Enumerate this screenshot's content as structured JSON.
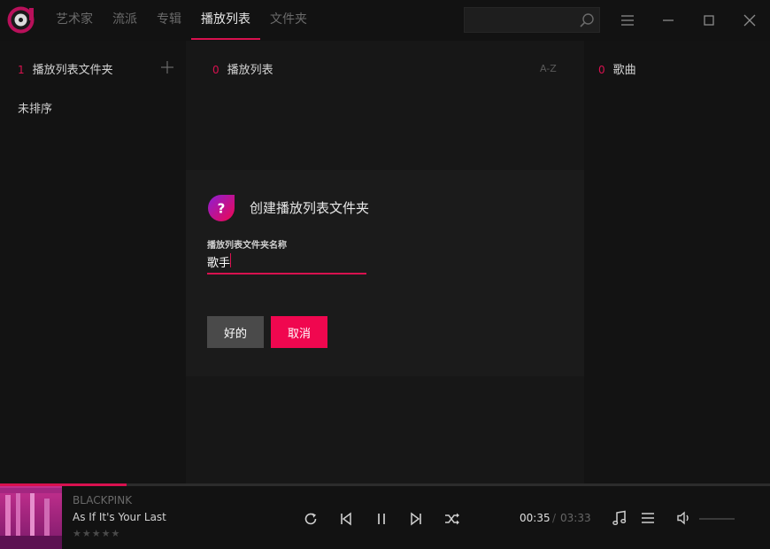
{
  "nav": {
    "tabs": [
      {
        "label": "艺术家"
      },
      {
        "label": "流派"
      },
      {
        "label": "专辑"
      },
      {
        "label": "播放列表"
      },
      {
        "label": "文件夹"
      }
    ],
    "active_index": 3
  },
  "search": {
    "placeholder": "",
    "icon": "search-icon"
  },
  "window_controls": [
    "menu-icon",
    "minimize-icon",
    "maximize-icon",
    "close-icon"
  ],
  "left_column": {
    "count": "1",
    "header": "播放列表文件夹",
    "add_icon": "plus-icon",
    "items": [
      {
        "label": "未排序"
      }
    ]
  },
  "middle_column": {
    "count": "0",
    "header": "播放列表",
    "sort_label": "A-Z"
  },
  "right_column": {
    "count": "0",
    "header": "歌曲"
  },
  "dialog": {
    "title": "创建播放列表文件夹",
    "icon": "question-icon",
    "field_label": "播放列表文件夹名称",
    "field_value": "歌手",
    "ok_label": "好的",
    "cancel_label": "取消"
  },
  "player": {
    "artist": "BLACKPINK",
    "title": "As If It's Your Last",
    "rating": 0,
    "rating_max": 5,
    "time_current": "00:35",
    "time_separator": "/",
    "time_total": "03:33",
    "progress_fraction": 0.164,
    "controls": [
      "repeat-icon",
      "previous-icon",
      "pause-icon",
      "next-icon",
      "shuffle-icon"
    ],
    "right_controls": [
      "music-note-icon",
      "playlist-icon",
      "volume-icon"
    ]
  },
  "colors": {
    "accent": "#d8114f",
    "cancel_button": "#f0074f",
    "ok_button": "#4a4a4a",
    "background": "#161616"
  }
}
